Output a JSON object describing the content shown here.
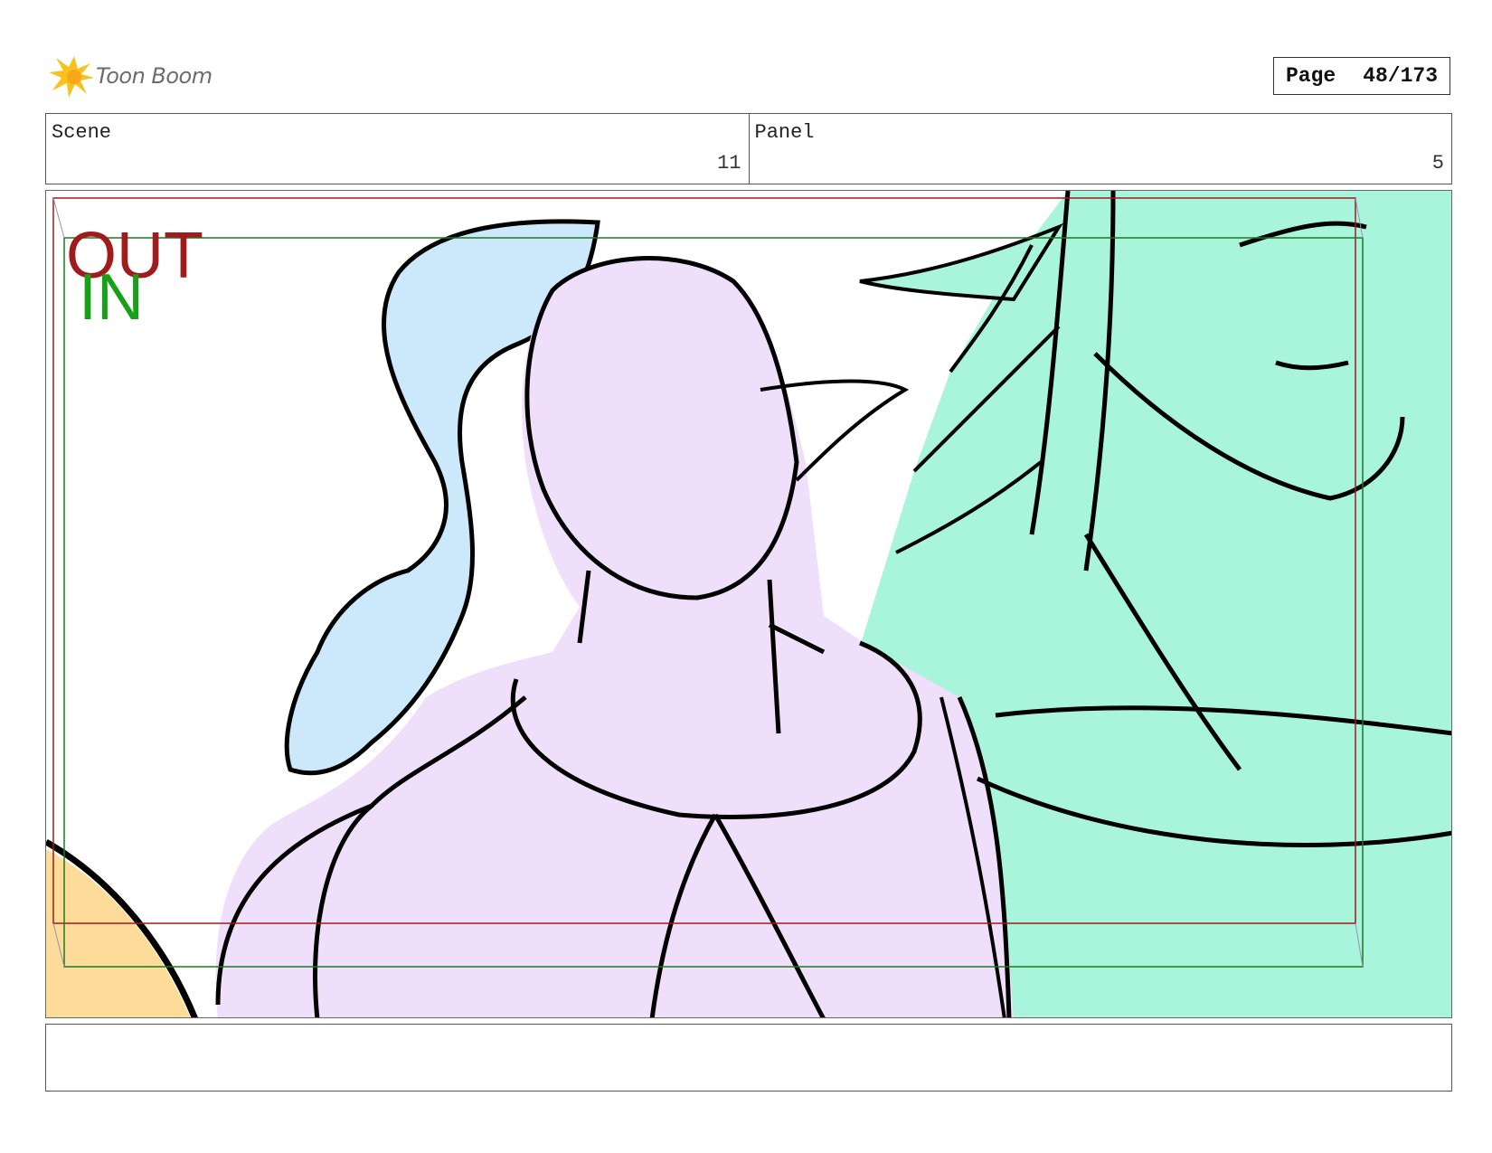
{
  "header": {
    "brand": "Toon Boom",
    "page_label": "Page",
    "page_number": "48/173"
  },
  "info": {
    "scene_label": "Scene",
    "scene_value": "11",
    "panel_label": "Panel",
    "panel_value": "5"
  },
  "frame": {
    "out_label": "OUT",
    "in_label": "IN",
    "colors": {
      "out_frame": "#a01b1b",
      "in_frame": "#1e7a1e",
      "in_text": "#18a018",
      "character_left_hair": "#cce9fb",
      "character_center": "#efdffb",
      "character_right": "#a8f5db",
      "corner_shape": "#fddc9a"
    }
  },
  "notes": {
    "text": ""
  }
}
